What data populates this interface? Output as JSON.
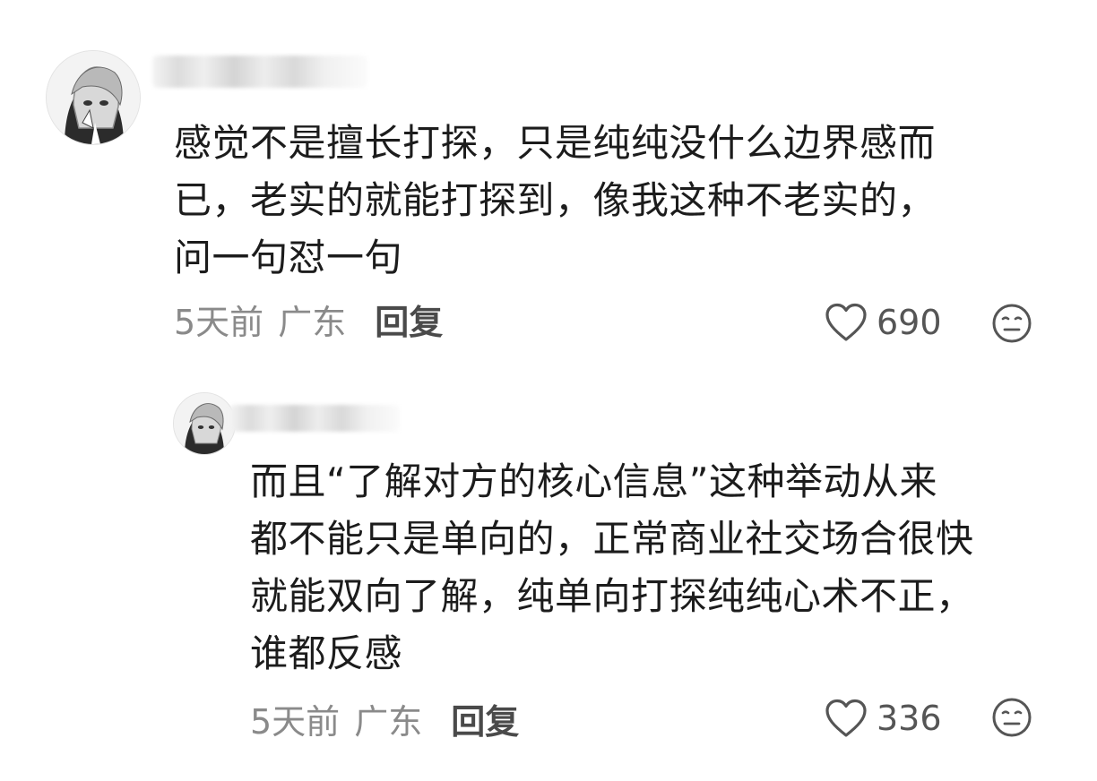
{
  "comments": [
    {
      "body": "感觉不是擅长打探，只是纯纯没什么边界感而\n已，老实的就能打探到，像我这种不老实的，\n问一句怼一句",
      "time": "5天前",
      "location": "广东",
      "reply_label": "回复",
      "like_count": "690"
    },
    {
      "body": "而且“了解对方的核心信息”这种举动从来\n都不能只是单向的，正常商业社交场合很快\n就能双向了解，纯单向打探纯纯心术不正，\n谁都反感",
      "time": "5天前",
      "location": "广东",
      "reply_label": "回复",
      "like_count": "336"
    }
  ],
  "icons": {
    "like": "heart-outline-icon",
    "reaction": "neutral-face-icon",
    "avatar": "anime-avatar"
  },
  "colors": {
    "text": "#1c1c1c",
    "meta": "#8a8a8a",
    "reply": "#4a4a4a",
    "icon": "#555555"
  }
}
